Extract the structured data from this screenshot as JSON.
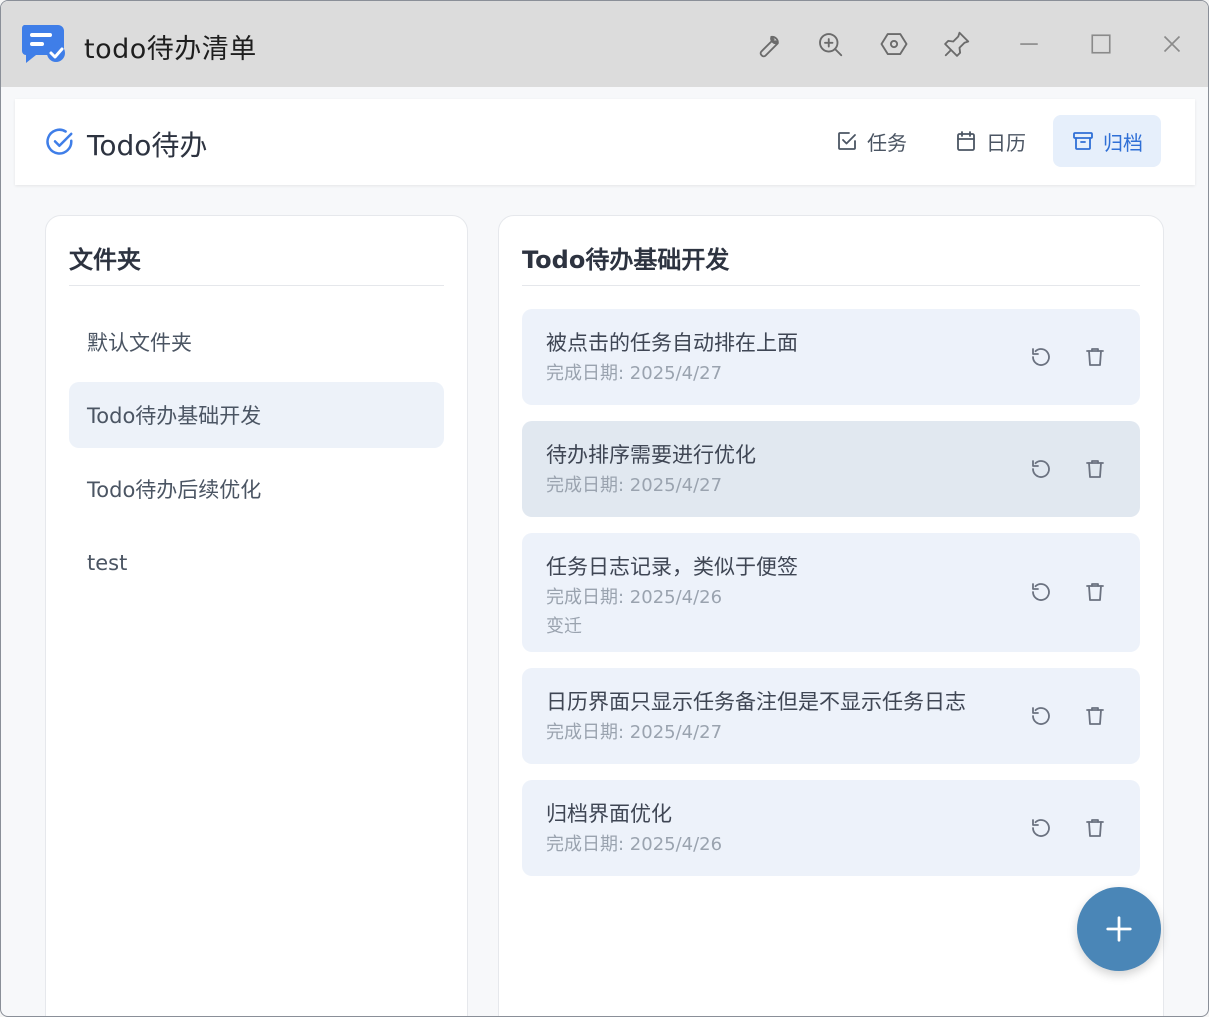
{
  "window": {
    "title": "todo待办清单"
  },
  "titlebar": {
    "icons": [
      "wrench-icon",
      "zoom-in-icon",
      "hexagon-settings-icon",
      "pin-icon",
      "minimize-icon",
      "maximize-icon",
      "close-icon"
    ]
  },
  "header": {
    "brand": "Todo待办",
    "tabs": [
      {
        "label": "任务",
        "icon": "checkbox-icon",
        "active": false
      },
      {
        "label": "日历",
        "icon": "calendar-icon",
        "active": false
      },
      {
        "label": "归档",
        "icon": "archive-icon",
        "active": true
      }
    ]
  },
  "folders": {
    "title": "文件夹",
    "items": [
      {
        "label": "默认文件夹",
        "active": false
      },
      {
        "label": "Todo待办基础开发",
        "active": true
      },
      {
        "label": "Todo待办后续优化",
        "active": false
      },
      {
        "label": "test",
        "active": false
      }
    ]
  },
  "tasks": {
    "title": "Todo待办基础开发",
    "items": [
      {
        "title": "被点击的任务自动排在上面",
        "date": "完成日期: 2025/4/27",
        "note": ""
      },
      {
        "title": "待办排序需要进行优化",
        "date": "完成日期: 2025/4/27",
        "note": ""
      },
      {
        "title": "任务日志记录，类似于便签",
        "date": "完成日期: 2025/4/26",
        "note": "变迁"
      },
      {
        "title": "日历界面只显示任务备注但是不显示任务日志",
        "date": "完成日期: 2025/4/27",
        "note": ""
      },
      {
        "title": "归档界面优化",
        "date": "完成日期: 2025/4/26",
        "note": ""
      }
    ]
  },
  "colors": {
    "accent": "#2f6fd6",
    "fab": "#4a86b7",
    "card": "#edf2fa",
    "card_hover": "#e1e8f0",
    "titlebar": "#dcdcdc"
  }
}
